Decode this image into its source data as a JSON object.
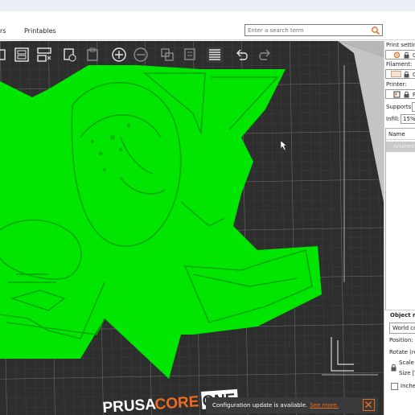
{
  "nav": {
    "tabs": [
      "rs",
      "Printables"
    ],
    "search_placeholder": "Enter a search term"
  },
  "viewport": {
    "printer_brand": "PRUSA",
    "printer_model_core": "CORE",
    "printer_model_one": "ONE",
    "model_color": "#00e600",
    "bed_color": "#2e2e2e",
    "accent_color": "#ed6b21"
  },
  "toolbar": {
    "icons": [
      "add-icon",
      "delete-icon",
      "delete-all-icon",
      "arrange-icon",
      "copy-icon",
      "paste-icon",
      "add-instance-icon",
      "remove-instance-icon",
      "split-objects-icon",
      "split-parts-icon",
      "variable-layer-height-icon",
      "undo-icon",
      "redo-icon"
    ]
  },
  "notification": {
    "text": "Configuration update is available.",
    "link": "See more."
  },
  "sidebar": {
    "print_settings_label": "Print setting",
    "print_settings_value": "0.",
    "filament_label": "Filament:",
    "filament_value": "G",
    "filament_color": "#f6e0cf",
    "printer_label": "Printer:",
    "printer_value": "P",
    "supports_label": "Supports:",
    "infill_label": "Infill:",
    "infill_value": "15%",
    "name_column": "Name",
    "object_name": "Anaheim",
    "object_manip_title": "Object m",
    "coord_system": "World co",
    "position_label": "Position:",
    "rotation_label": "Rotate (rel",
    "scale_label": "Scale f",
    "size_label": "Size [V",
    "inches_label": "Inches"
  }
}
